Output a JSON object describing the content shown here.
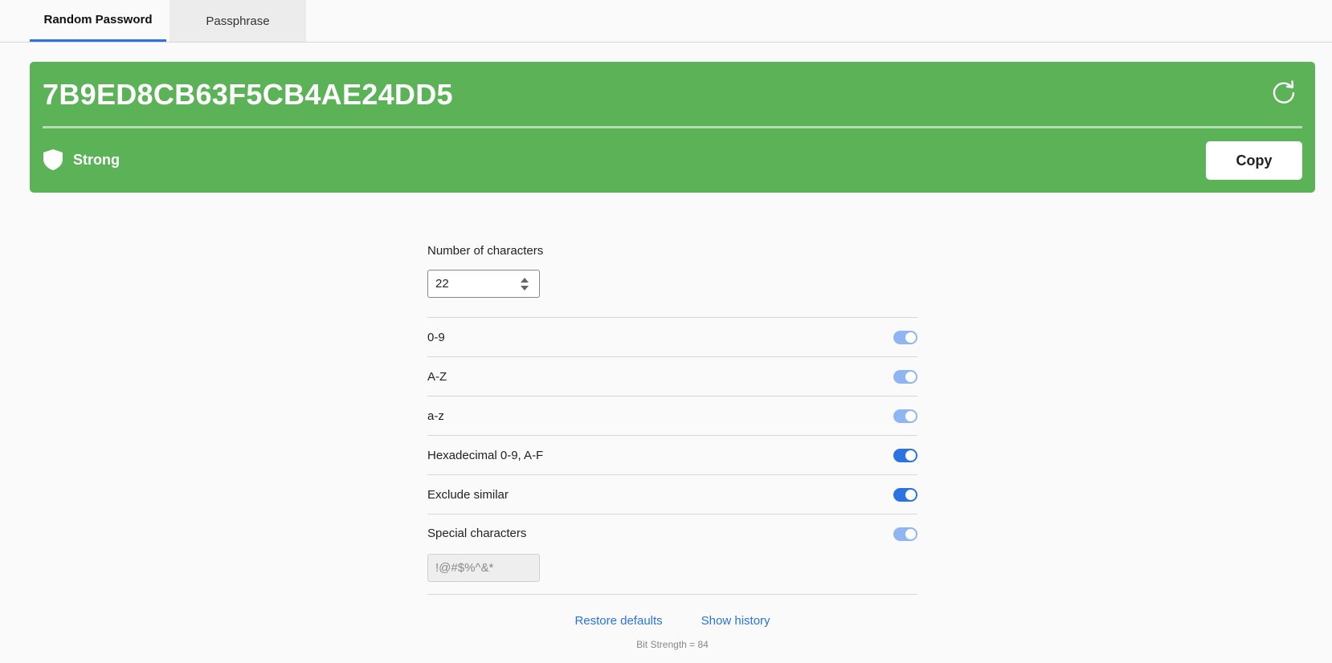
{
  "tabs": [
    {
      "label": "Random Password",
      "active": true
    },
    {
      "label": "Passphrase",
      "active": false
    }
  ],
  "banner": {
    "password": "7B9ED8CB63F5CB4AE24DD5",
    "strength_label": "Strong",
    "copy_label": "Copy",
    "color": "#5cb357",
    "icons": {
      "refresh": "refresh-icon",
      "strength": "shield-icon"
    }
  },
  "options": {
    "num_label": "Number of characters",
    "num_value": "22",
    "rows": [
      {
        "label": "0-9",
        "state": "on-disabled"
      },
      {
        "label": "A-Z",
        "state": "on-disabled"
      },
      {
        "label": "a-z",
        "state": "on-disabled"
      },
      {
        "label": "Hexadecimal 0-9, A-F",
        "state": "on"
      },
      {
        "label": "Exclude similar",
        "state": "on"
      },
      {
        "label": "Special characters",
        "state": "on-disabled"
      }
    ],
    "special_value": "!@#$%^&*"
  },
  "footer": {
    "restore_label": "Restore defaults",
    "history_label": "Show history",
    "bit_strength": "Bit Strength = 84"
  },
  "colors": {
    "accent": "#2a73e0",
    "toggle_dim": "#8fb6f2"
  }
}
